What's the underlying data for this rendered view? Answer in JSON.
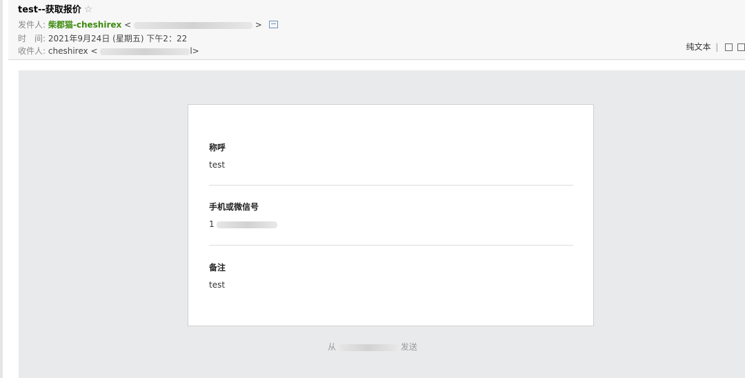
{
  "email": {
    "subject": "test--获取报价",
    "from_label": "发件人:",
    "from_name": "柴郡猫-cheshirex",
    "from_open": "<",
    "from_close": ">",
    "time_label": "时　间:",
    "time_value": "2021年9月24日 (星期五) 下午2：22",
    "to_label": "收件人:",
    "to_name": "cheshirex",
    "to_open": "<",
    "to_close": "l>"
  },
  "toolbar": {
    "plain_text_label": "纯文本",
    "separator": "|"
  },
  "fields": [
    {
      "label": "称呼",
      "value": "test"
    },
    {
      "label": "手机或微信号",
      "value": "1"
    },
    {
      "label": "备注",
      "value": "test"
    }
  ],
  "footer": {
    "prefix": "从",
    "suffix": "发送"
  },
  "icons": {
    "star": "star-outline-icon",
    "address_book": "address-card-icon",
    "restore_window": "restore-window-icon",
    "new_window": "new-window-icon"
  },
  "colors": {
    "sender_name": "#3d8a0e",
    "content_background": "#e9eaeb",
    "header_background": "#f7f7f7"
  }
}
